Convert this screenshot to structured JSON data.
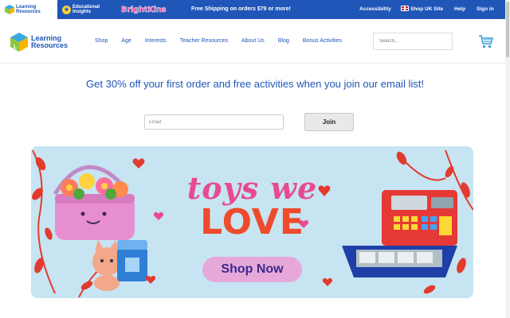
{
  "topbar": {
    "brands": [
      {
        "name": "Learning Resources",
        "line1": "Learning",
        "line2": "Resources"
      },
      {
        "name": "Educational Insights",
        "line1": "Educational",
        "line2": "Insights"
      },
      {
        "name": "BrightKins",
        "label": "BrightKins"
      }
    ],
    "shipping": "Free Shipping on orders $79 or more!",
    "accessibility": "Accessibility",
    "uk_site": "Shop UK Site",
    "help": "Help",
    "signin": "Sign in"
  },
  "header": {
    "logo_line1": "Learning",
    "logo_line2": "Resources",
    "nav": [
      "Shop",
      "Age",
      "Interests",
      "Teacher Resources",
      "About Us",
      "Blog",
      "Bonus Activities"
    ],
    "search_placeholder": "Search..."
  },
  "promo": {
    "headline": "Get 30% off your first order and free activities when you join our email list!",
    "email_placeholder": "Email",
    "join_label": "Join"
  },
  "banner": {
    "line1": "toys we",
    "line2": "LOVE",
    "cta": "Shop Now",
    "colors": {
      "bg": "#c7e4f2",
      "pink": "#e84a8f",
      "red": "#ef4a2b",
      "button": "#e6a8d9",
      "button_text": "#3b2a8c"
    }
  },
  "colors": {
    "brand_blue": "#1f56b8"
  }
}
